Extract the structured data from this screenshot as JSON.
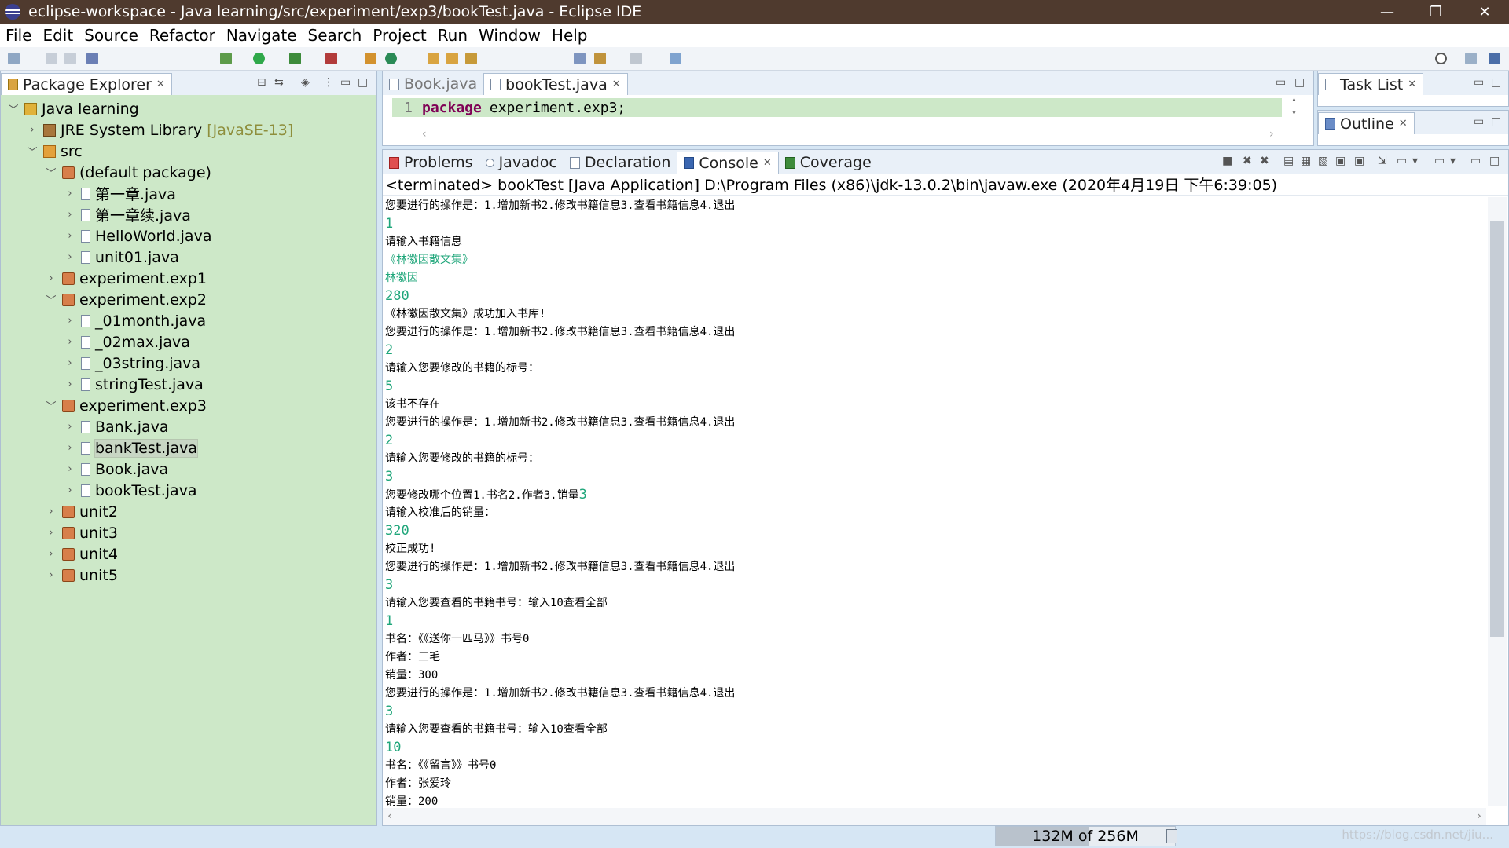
{
  "window": {
    "title": "eclipse-workspace - Java learning/src/experiment/exp3/bookTest.java - Eclipse IDE",
    "minimize": "—",
    "restore": "❐",
    "close": "✕"
  },
  "menu": [
    "File",
    "Edit",
    "Source",
    "Refactor",
    "Navigate",
    "Search",
    "Project",
    "Run",
    "Window",
    "Help"
  ],
  "package_explorer": {
    "title": "Package Explorer",
    "close": "✕",
    "tree": [
      {
        "label": "Java learning",
        "depth": 0,
        "arrow": "﹀",
        "icon": "proj"
      },
      {
        "label": "JRE System Library",
        "sub": "[JavaSE-13]",
        "depth": 1,
        "arrow": "›",
        "icon": "lib"
      },
      {
        "label": "src",
        "depth": 1,
        "arrow": "﹀",
        "icon": "src"
      },
      {
        "label": "(default package)",
        "depth": 2,
        "arrow": "﹀",
        "icon": "pkg"
      },
      {
        "label": "第一章.java",
        "depth": 3,
        "arrow": "›",
        "icon": "java"
      },
      {
        "label": "第一章续.java",
        "depth": 3,
        "arrow": "›",
        "icon": "java"
      },
      {
        "label": "HelloWorld.java",
        "depth": 3,
        "arrow": "›",
        "icon": "java"
      },
      {
        "label": "unit01.java",
        "depth": 3,
        "arrow": "›",
        "icon": "java"
      },
      {
        "label": "experiment.exp1",
        "depth": 2,
        "arrow": "›",
        "icon": "pkg"
      },
      {
        "label": "experiment.exp2",
        "depth": 2,
        "arrow": "﹀",
        "icon": "pkg"
      },
      {
        "label": "_01month.java",
        "depth": 3,
        "arrow": "›",
        "icon": "java"
      },
      {
        "label": "_02max.java",
        "depth": 3,
        "arrow": "›",
        "icon": "java"
      },
      {
        "label": "_03string.java",
        "depth": 3,
        "arrow": "›",
        "icon": "java"
      },
      {
        "label": "stringTest.java",
        "depth": 3,
        "arrow": "›",
        "icon": "java"
      },
      {
        "label": "experiment.exp3",
        "depth": 2,
        "arrow": "﹀",
        "icon": "pkg"
      },
      {
        "label": "Bank.java",
        "depth": 3,
        "arrow": "›",
        "icon": "java"
      },
      {
        "label": "bankTest.java",
        "depth": 3,
        "arrow": "›",
        "icon": "java",
        "selected": true
      },
      {
        "label": "Book.java",
        "depth": 3,
        "arrow": "›",
        "icon": "java"
      },
      {
        "label": "bookTest.java",
        "depth": 3,
        "arrow": "›",
        "icon": "java"
      },
      {
        "label": "unit2",
        "depth": 2,
        "arrow": "›",
        "icon": "pkg"
      },
      {
        "label": "unit3",
        "depth": 2,
        "arrow": "›",
        "icon": "pkg"
      },
      {
        "label": "unit4",
        "depth": 2,
        "arrow": "›",
        "icon": "pkg"
      },
      {
        "label": "unit5",
        "depth": 2,
        "arrow": "›",
        "icon": "pkg"
      }
    ]
  },
  "editor": {
    "tabs": [
      {
        "label": "Book.java",
        "active": false
      },
      {
        "label": "bookTest.java",
        "active": true
      }
    ],
    "line_number": "1",
    "keyword": "package",
    "code": "experiment.exp3;"
  },
  "task_list": {
    "title": "Task List"
  },
  "outline": {
    "title": "Outline"
  },
  "console_view": {
    "tabs": [
      "Problems",
      "Javadoc",
      "Declaration",
      "Console",
      "Coverage"
    ],
    "active_tab": "Console",
    "header": "<terminated> bookTest [Java Application] D:\\Program Files (x86)\\jdk-13.0.2\\bin\\javaw.exe (2020年4月19日 下午6:39:05)",
    "lines": [
      {
        "text": "您要进行的操作是：1.增加新书2.修改书籍信息3.查看书籍信息4.退出",
        "type": "out"
      },
      {
        "text": "1",
        "type": "in"
      },
      {
        "text": "请输入书籍信息",
        "type": "out"
      },
      {
        "text": "《林徽因散文集》",
        "type": "in_small"
      },
      {
        "text": "林徽因",
        "type": "in_small"
      },
      {
        "text": "280",
        "type": "in"
      },
      {
        "text": "《林徽因散文集》成功加入书库!",
        "type": "out"
      },
      {
        "text": "您要进行的操作是：1.增加新书2.修改书籍信息3.查看书籍信息4.退出",
        "type": "out"
      },
      {
        "text": "2",
        "type": "in"
      },
      {
        "text": "请输入您要修改的书籍的标号：",
        "type": "out"
      },
      {
        "text": "5",
        "type": "in"
      },
      {
        "text": "该书不存在",
        "type": "out"
      },
      {
        "text": "您要进行的操作是：1.增加新书2.修改书籍信息3.查看书籍信息4.退出",
        "type": "out"
      },
      {
        "text": "2",
        "type": "in"
      },
      {
        "text": "请输入您要修改的书籍的标号：",
        "type": "out"
      },
      {
        "text": "3",
        "type": "in"
      },
      {
        "text": "您要修改哪个位置1.书名2.作者3.销量",
        "type": "out",
        "suffix": "3"
      },
      {
        "text": "请输入校准后的销量：",
        "type": "out"
      },
      {
        "text": "320",
        "type": "in"
      },
      {
        "text": "校正成功!",
        "type": "out"
      },
      {
        "text": "您要进行的操作是：1.增加新书2.修改书籍信息3.查看书籍信息4.退出",
        "type": "out"
      },
      {
        "text": "3",
        "type": "in"
      },
      {
        "text": "请输入您要查看的书籍书号：输入10查看全部",
        "type": "out"
      },
      {
        "text": "1",
        "type": "in"
      },
      {
        "text": "书名：《《送你一匹马》》书号0",
        "type": "out"
      },
      {
        "text": "作者：三毛",
        "type": "out"
      },
      {
        "text": "销量：300",
        "type": "out"
      },
      {
        "text": "您要进行的操作是：1.增加新书2.修改书籍信息3.查看书籍信息4.退出",
        "type": "out"
      },
      {
        "text": "3",
        "type": "in"
      },
      {
        "text": "请输入您要查看的书籍书号：输入10查看全部",
        "type": "out"
      },
      {
        "text": "10",
        "type": "in"
      },
      {
        "text": "书名：《《留言》》书号0",
        "type": "out"
      },
      {
        "text": "作者：张爱玲",
        "type": "out"
      },
      {
        "text": "销量：200",
        "type": "out"
      }
    ]
  },
  "status": {
    "heap": "132M of 256M",
    "heap_fraction": 0.52,
    "watermark": "https://blog.csdn.net/jiu..."
  },
  "colors": {
    "input_text": "#1fa67a",
    "tree_bg": "#cde8c8",
    "title_bar": "#4f3a2e"
  }
}
